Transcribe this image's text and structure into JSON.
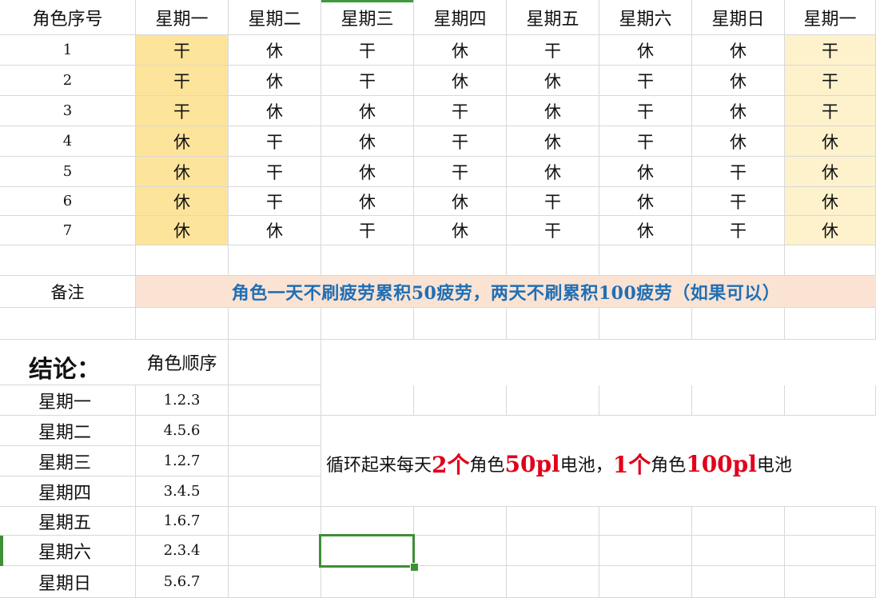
{
  "colors": {
    "monday_first": "#fde49b",
    "monday_next": "#fdf2cc",
    "note_bg": "#fbe3d4",
    "note_text": "#1f6fb5",
    "highlight_red": "#e0001b",
    "selection_green": "#3e8f35"
  },
  "schedule": {
    "headers": [
      "角色序号",
      "星期一",
      "星期二",
      "星期三",
      "星期四",
      "星期五",
      "星期六",
      "星期日",
      "星期一"
    ],
    "rows": [
      [
        "1",
        "干",
        "休",
        "干",
        "休",
        "干",
        "休",
        "休",
        "干"
      ],
      [
        "2",
        "干",
        "休",
        "干",
        "休",
        "休",
        "干",
        "休",
        "干"
      ],
      [
        "3",
        "干",
        "休",
        "休",
        "干",
        "休",
        "干",
        "休",
        "干"
      ],
      [
        "4",
        "休",
        "干",
        "休",
        "干",
        "休",
        "干",
        "休",
        "休"
      ],
      [
        "5",
        "休",
        "干",
        "休",
        "干",
        "休",
        "休",
        "干",
        "休"
      ],
      [
        "6",
        "休",
        "干",
        "休",
        "休",
        "干",
        "休",
        "干",
        "休"
      ],
      [
        "7",
        "休",
        "休",
        "干",
        "休",
        "干",
        "休",
        "干",
        "休"
      ]
    ]
  },
  "note": {
    "label": "备注",
    "text": "角色一天不刷疲劳累积50疲劳，两天不刷累积100疲劳（如果可以）"
  },
  "conclusion": {
    "title": "结论：",
    "order_header": "角色顺序",
    "days": [
      {
        "day": "星期一",
        "order": "1.2.3"
      },
      {
        "day": "星期二",
        "order": "4.5.6"
      },
      {
        "day": "星期三",
        "order": "1.2.7"
      },
      {
        "day": "星期四",
        "order": "3.4.5"
      },
      {
        "day": "星期五",
        "order": "1.6.7"
      },
      {
        "day": "星期六",
        "order": "2.3.4"
      },
      {
        "day": "星期日",
        "order": "5.6.7"
      }
    ]
  },
  "summary": {
    "p1": "循环起来每天",
    "n1": "2个",
    "p2": "角色",
    "n2": "50pl",
    "p3": "电池，",
    "n3": "1个",
    "p4": "角色",
    "n4": "100pl",
    "p5": "电池"
  }
}
